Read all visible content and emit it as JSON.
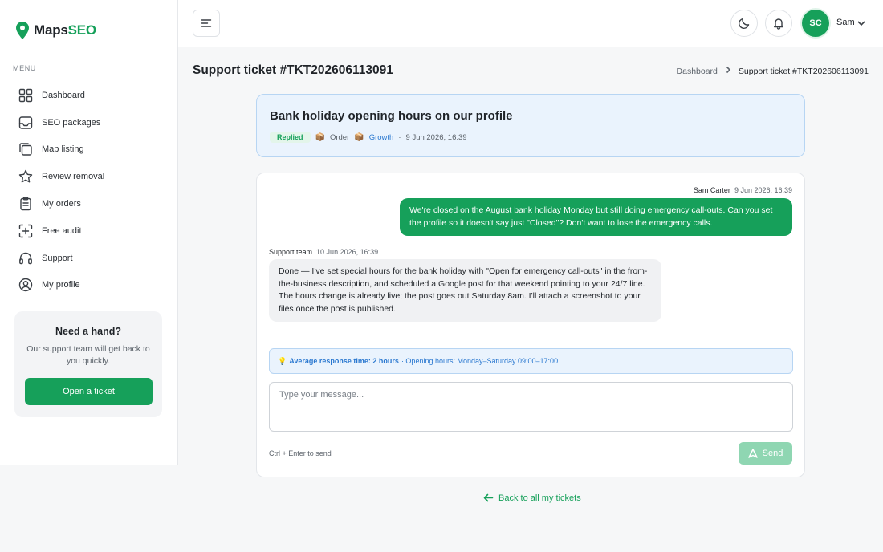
{
  "brand": {
    "name_part1": "Maps",
    "name_part2": "SEO",
    "accent_color": "#16a05a"
  },
  "sidebar": {
    "menu_label": "MENU",
    "items": [
      {
        "label": "Dashboard",
        "icon": "grid-icon"
      },
      {
        "label": "SEO packages",
        "icon": "inbox-icon"
      },
      {
        "label": "Map listing",
        "icon": "copy-icon"
      },
      {
        "label": "Review removal",
        "icon": "star-icon"
      },
      {
        "label": "My orders",
        "icon": "clipboard-icon"
      },
      {
        "label": "Free audit",
        "icon": "scan-plus-icon"
      },
      {
        "label": "Support",
        "icon": "headset-icon"
      },
      {
        "label": "My profile",
        "icon": "user-circle-icon"
      }
    ],
    "help": {
      "title": "Need a hand?",
      "text": "Our support team will get back to you quickly.",
      "button": "Open a ticket"
    }
  },
  "header": {
    "user_initials": "SC",
    "user_name": "Sam"
  },
  "page": {
    "title": "Support ticket #TKT202606113091",
    "breadcrumb": {
      "home": "Dashboard",
      "current": "Support ticket #TKT202606113091"
    }
  },
  "ticket": {
    "subject": "Bank holiday opening hours on our profile",
    "status": "Replied",
    "order_label": "Order",
    "package_label": "Growth",
    "separator": "·",
    "created": "9 Jun 2026, 16:39"
  },
  "messages": [
    {
      "author": "Sam Carter",
      "time": "9 Jun 2026, 16:39",
      "text": "We're closed on the August bank holiday Monday but still doing emergency call-outs. Can you set the profile so it doesn't say just \"Closed\"? Don't want to lose the emergency calls."
    },
    {
      "author": "Support team",
      "time": "10 Jun 2026, 16:39",
      "text": "Done — I've set special hours for the bank holiday with \"Open for emergency call-outs\" in the from-the-business description, and scheduled a Google post for that weekend pointing to your 24/7 line. The hours change is already live; the post goes out Saturday 8am. I'll attach a screenshot to your files once the post is published."
    }
  ],
  "composer": {
    "info_icon": "💡",
    "info_bold": "Average response time: 2 hours",
    "info_rest": "· Opening hours: Monday–Saturday 09:00–17:00",
    "placeholder": "Type your message...",
    "hint": "Ctrl + Enter to send",
    "send_label": "Send"
  },
  "back_link": "Back to all my tickets"
}
